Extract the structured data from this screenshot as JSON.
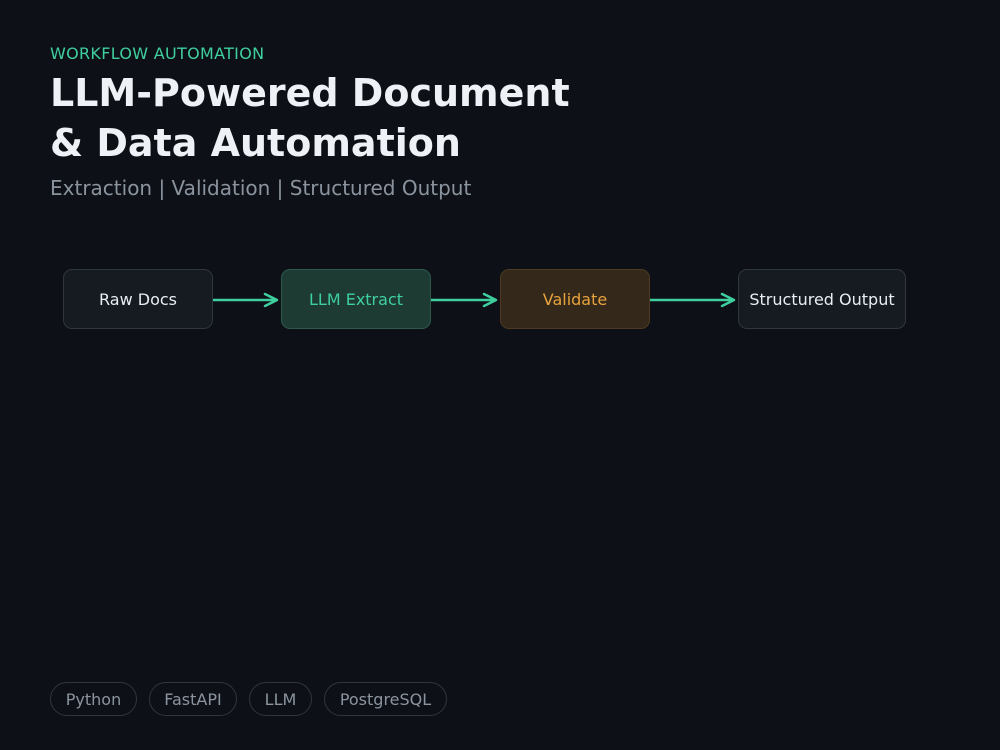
{
  "header": {
    "eyebrow": "WORKFLOW AUTOMATION",
    "title_line1": "LLM-Powered Document",
    "title_line2": "& Data Automation",
    "subtitle": "Extraction | Validation | Structured Output"
  },
  "flow": {
    "nodes": [
      {
        "label": "Raw Docs",
        "text_color": "#e6edf3",
        "fill": "#161b22",
        "border": "#30363d"
      },
      {
        "label": "LLM Extract",
        "text_color": "#3fcf9e",
        "fill": "#1d3a33",
        "border": "#2e5a4c"
      },
      {
        "label": "Validate",
        "text_color": "#e8a33d",
        "fill": "#33281a",
        "border": "#4d3a20"
      },
      {
        "label": "Structured Output",
        "text_color": "#e6edf3",
        "fill": "#161b22",
        "border": "#30363d"
      }
    ],
    "arrow_color": "#3fcf9e"
  },
  "tags": [
    "Python",
    "FastAPI",
    "LLM",
    "PostgreSQL"
  ],
  "colors": {
    "background": "#0d1117",
    "accent": "#3fcf9e",
    "title": "#eef1f5",
    "muted": "#8b949e"
  }
}
